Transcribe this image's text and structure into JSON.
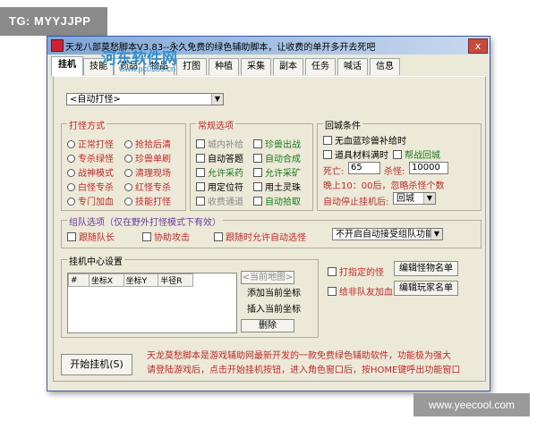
{
  "badge": {
    "text": "TG: MYYJJPP"
  },
  "window": {
    "title": "天龙八部莫愁脚本V3.83--永久免费的绿色辅助脚本，让收费的单开多开去死吧",
    "close": "x"
  },
  "tabs": [
    "挂机",
    "技能",
    "药品",
    "物品",
    "打图",
    "种植",
    "采集",
    "副本",
    "任务",
    "喊话",
    "信息"
  ],
  "watermark": {
    "name": "河东软件网",
    "url": "www.pc0359.cn"
  },
  "mode_select": "<自动打怪>",
  "attack_mode": {
    "title": "打怪方式",
    "options": [
      "正常打怪",
      "抢拾后清",
      "专杀绿怪",
      "珍兽单刷",
      "战神模式",
      "清理现场",
      "白怪专杀",
      "红怪专杀",
      "专门加血",
      "技能打怪"
    ]
  },
  "common": {
    "title": "常规选项",
    "options": [
      {
        "label": "城内补给",
        "color": "dim"
      },
      {
        "label": "珍兽出战",
        "color": "green"
      },
      {
        "label": "自动答题",
        "color": "black"
      },
      {
        "label": "自动合成",
        "color": "green"
      },
      {
        "label": "允许采药",
        "color": "green"
      },
      {
        "label": "允许采矿",
        "color": "green"
      },
      {
        "label": "用定位符",
        "color": "black"
      },
      {
        "label": "用土灵珠",
        "color": "black"
      },
      {
        "label": "收费通道",
        "color": "dim"
      },
      {
        "label": "自动拾取",
        "color": "green"
      }
    ]
  },
  "return": {
    "title": "回城条件",
    "no_pet_food": "无血蓝珍兽补给时",
    "items_full": "道具材料满时",
    "gang_return": "帮战回城",
    "death_label": "死亡:",
    "death_value": "65",
    "kill_label": "杀怪:",
    "kill_value": "10000",
    "evening_note": "晚上10：00后，忽略杀怪个数",
    "auto_stop_label": "自动停止挂机后:",
    "auto_stop_value": "回城"
  },
  "team": {
    "title": "组队选项（仅在野外打怪模式下有效）",
    "follow_leader": "跟随队长",
    "assist": "协助攻击",
    "follow_allow": "跟随时允许自动选怪",
    "accept_value": "不开启自动接受组队功能"
  },
  "center": {
    "title": "挂机中心设置",
    "columns": [
      "#",
      "坐标X",
      "坐标Y",
      "半径R"
    ],
    "current_map": "<当前地图>",
    "add_btn": "添加当前坐标",
    "insert_btn": "插入当前坐标",
    "delete_btn": "删除"
  },
  "special": {
    "hit_target": "打指定的怪",
    "edit_monsters": "编辑怪物名单",
    "heal_friends": "给非队友加血",
    "edit_players": "编辑玩家名单"
  },
  "start_button": "开始挂机(S)",
  "footer": {
    "line1": "天龙莫愁脚本是游戏辅助网最新开发的一款免费绿色辅助软件，功能极为强大",
    "line2": "请登陆游戏后，点击开始挂机按钮，进入角色窗口后，按HOME键呼出功能窗口"
  },
  "corner_watermark": "www.yeecool.com"
}
